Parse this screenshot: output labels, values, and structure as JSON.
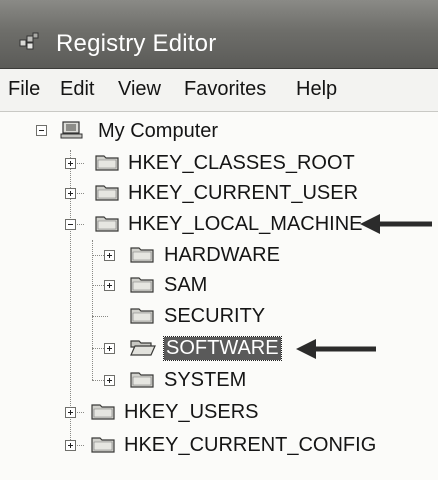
{
  "window": {
    "title": "Registry Editor",
    "title_icon": "registry-editor-icon"
  },
  "menu": [
    "File",
    "Edit",
    "View",
    "Favorites",
    "Help"
  ],
  "tree": {
    "root": "My Computer",
    "keys": [
      "HKEY_CLASSES_ROOT",
      "HKEY_CURRENT_USER",
      "HKEY_LOCAL_MACHINE",
      "HKEY_USERS",
      "HKEY_CURRENT_CONFIG"
    ],
    "local_machine_children": [
      "HARDWARE",
      "SAM",
      "SECURITY",
      "SOFTWARE",
      "SYSTEM"
    ],
    "selected": "SOFTWARE"
  },
  "annotations": {
    "arrow_icon": "left-arrow-icon"
  }
}
